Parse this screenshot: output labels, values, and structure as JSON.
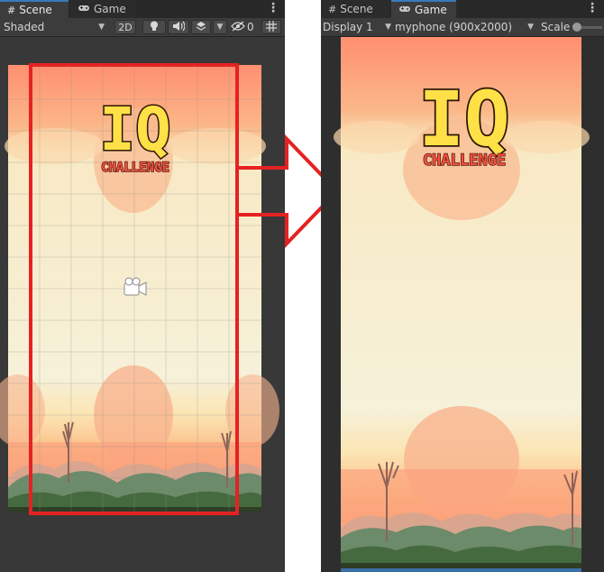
{
  "scene_panel": {
    "tab_label": "Scene",
    "tab_icon": "grid-icon",
    "game_tab_label": "Game",
    "game_tab_icon": "gamepad-icon",
    "menu_glyph": "⋮",
    "draw_mode": "Shaded",
    "button_2d": "2D",
    "hidden_count": "0",
    "icons": [
      "lightbulb-icon",
      "audio-icon",
      "layers-icon",
      "visibility-icon",
      "grid-snap-icon"
    ]
  },
  "game_panel": {
    "scene_tab_label": "Scene",
    "tab_label": "Game",
    "display": "Display 1",
    "resolution": "myphone (900x2000)",
    "scale_label": "Scale"
  },
  "logo": {
    "main": "IQ",
    "sub": "CHALLENGE"
  },
  "colors": {
    "editor_bg": "#383838",
    "tab_bg": "#282828",
    "selection_red": "#e52222",
    "logo_yellow": "#ffe046",
    "logo_outline": "#2b1606",
    "sky_top": "#ff8f70",
    "sky_pale": "#f6f1d9",
    "hill": "#6c8b6a"
  }
}
